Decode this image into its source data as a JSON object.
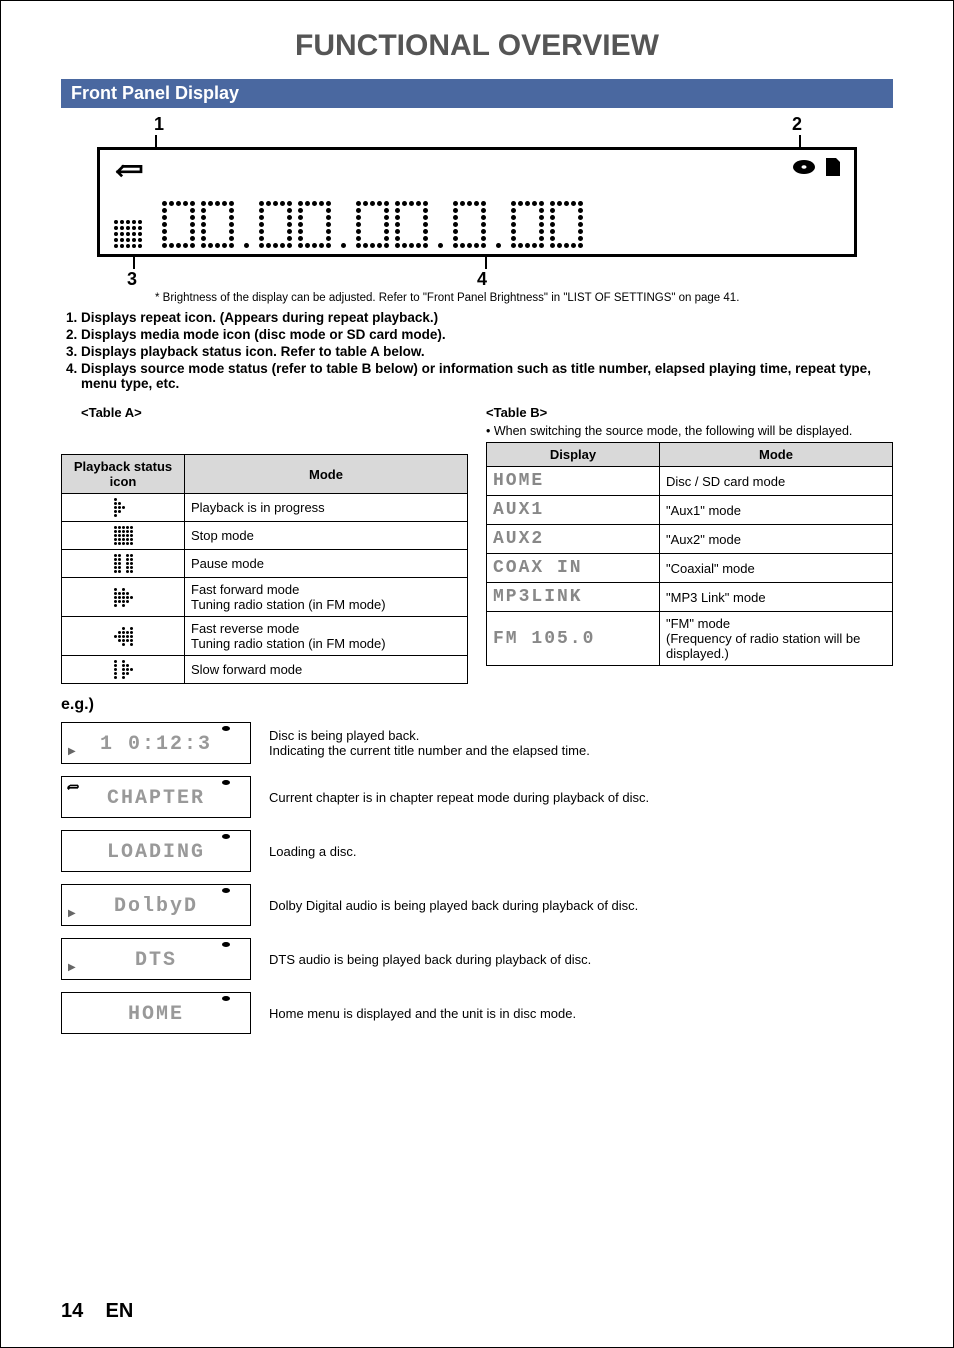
{
  "title": "FUNCTIONAL OVERVIEW",
  "section_heading": "Front Panel Display",
  "diagram": {
    "callout1": "1",
    "callout2": "2",
    "callout3": "3",
    "callout4": "4"
  },
  "brightness_note": "* Brightness of the display can be adjusted. Refer to \"Front Panel Brightness\" in \"LIST OF SETTINGS\" on page 41.",
  "descriptions": [
    "Displays repeat icon. (Appears during repeat playback.)",
    "Displays media mode icon (disc mode or SD card mode).",
    "Displays playback status icon. Refer to table A below.",
    "Displays source mode status (refer to table B below) or information such as title number, elapsed playing time, repeat type, menu type, etc."
  ],
  "tableA": {
    "label": "<Table A>",
    "head_icon": "Playback status icon",
    "head_mode": "Mode",
    "rows": [
      {
        "mode": "Playback is in progress"
      },
      {
        "mode": "Stop mode"
      },
      {
        "mode": "Pause mode"
      },
      {
        "mode": "Fast forward mode\nTuning radio station (in FM mode)"
      },
      {
        "mode": "Fast reverse mode\nTuning radio station (in FM mode)"
      },
      {
        "mode": "Slow forward mode"
      }
    ]
  },
  "tableB": {
    "label": "<Table B>",
    "note": "• When switching the source mode, the following will be displayed.",
    "head_display": "Display",
    "head_mode": "Mode",
    "rows": [
      {
        "display": "HOME",
        "mode": "Disc / SD card mode"
      },
      {
        "display": "AUX1",
        "mode": "\"Aux1\" mode"
      },
      {
        "display": "AUX2",
        "mode": "\"Aux2\" mode"
      },
      {
        "display": "COAX IN",
        "mode": "\"Coaxial\" mode"
      },
      {
        "display": "MP3LINK",
        "mode": "\"MP3 Link\" mode"
      },
      {
        "display": "FM 105.0",
        "mode": "\"FM\" mode\n(Frequency of radio station will be displayed.)"
      }
    ]
  },
  "eg_label": "e.g.)",
  "examples": [
    {
      "display": "1    0:12:3",
      "play": true,
      "repeat": false,
      "desc": "Disc is being played back.\nIndicating the current title number and the elapsed time."
    },
    {
      "display": "CHAPTER",
      "play": false,
      "repeat": true,
      "desc": "Current chapter is in chapter repeat mode during playback of disc."
    },
    {
      "display": "LOADING",
      "play": false,
      "repeat": false,
      "desc": "Loading a disc."
    },
    {
      "display": "DolbyD",
      "play": true,
      "repeat": false,
      "desc": "Dolby Digital audio is being played back during playback of disc."
    },
    {
      "display": "DTS",
      "play": true,
      "repeat": false,
      "desc": "DTS audio is being played back during playback of disc."
    },
    {
      "display": "HOME",
      "play": false,
      "repeat": false,
      "desc": "Home menu is displayed and the unit is in disc mode."
    }
  ],
  "footer": {
    "page": "14",
    "lang": "EN"
  }
}
